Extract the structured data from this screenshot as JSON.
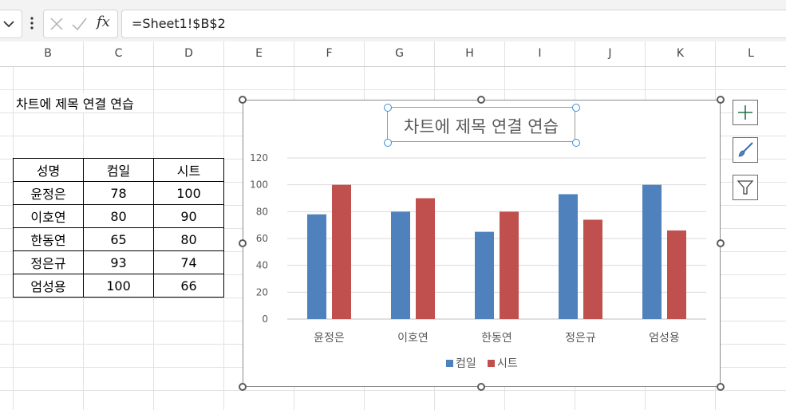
{
  "formula_bar": {
    "formula": "=Sheet1!$B$2",
    "fx_label": "fx"
  },
  "columns": [
    "B",
    "C",
    "D",
    "E",
    "F",
    "G",
    "H",
    "I",
    "J",
    "K",
    "L"
  ],
  "sheet": {
    "b2_text": "차트에 제목 연결 연습",
    "table": {
      "headers": [
        "성명",
        "컴일",
        "시트"
      ],
      "rows": [
        [
          "윤정은",
          "78",
          "100"
        ],
        [
          "이호연",
          "80",
          "90"
        ],
        [
          "한동연",
          "65",
          "80"
        ],
        [
          "정은규",
          "93",
          "74"
        ],
        [
          "엄성용",
          "100",
          "66"
        ]
      ]
    }
  },
  "chart_data": {
    "type": "bar",
    "title": "차트에 제목 연결 연습",
    "categories": [
      "윤정은",
      "이호연",
      "한동연",
      "정은규",
      "엄성용"
    ],
    "series": [
      {
        "name": "컴일",
        "values": [
          78,
          80,
          65,
          93,
          100
        ],
        "color": "#4f81bd"
      },
      {
        "name": "시트",
        "values": [
          100,
          90,
          80,
          74,
          66
        ],
        "color": "#c0504d"
      }
    ],
    "ylim": [
      0,
      120
    ],
    "yticks": [
      0,
      20,
      40,
      60,
      80,
      100,
      120
    ],
    "grid": true,
    "legend": "bottom"
  },
  "side_buttons": [
    "plus-icon",
    "brush-icon",
    "filter-icon"
  ],
  "colors": {
    "accent_green": "#217346",
    "grid": "#d9d9d9"
  }
}
